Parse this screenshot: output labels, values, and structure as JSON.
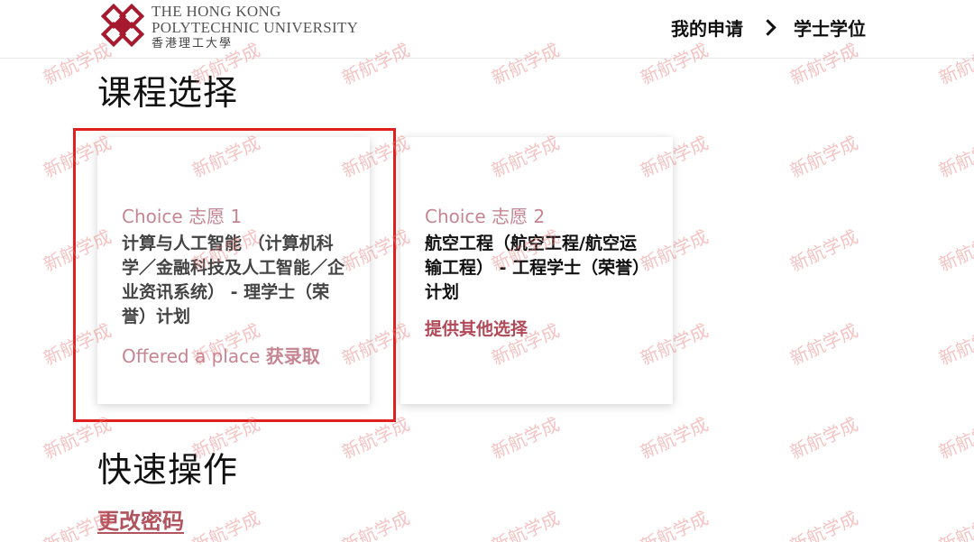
{
  "header": {
    "logo_line1": "The Hong Kong",
    "logo_line2": "Polytechnic University",
    "logo_line3": "香港理工大學",
    "breadcrumb": [
      "我的申请",
      "学士学位"
    ]
  },
  "sections": {
    "course_title": "课程选择",
    "quick_title": "快速操作"
  },
  "choices": [
    {
      "choice_label": "Choice 志愿 1",
      "program": "计算与人工智能 （计算机科学／金融科技及人工智能／企业资讯系统） - 理学士（荣誉）计划",
      "status_en": "Offered a place",
      "status_zh": "获录取"
    },
    {
      "choice_label": "Choice 志愿 2",
      "program": "航空工程（航空工程/航空运输工程） - 工程学士（荣誉）计划",
      "action": "提供其他选择"
    }
  ],
  "quick_actions": {
    "change_password": "更改密码"
  },
  "watermark": "新航学成",
  "colors": {
    "accent_pink": "#c58592",
    "accent_dark": "#b14a58",
    "highlight_red": "#e02020",
    "logo_red": "#a6192e"
  }
}
